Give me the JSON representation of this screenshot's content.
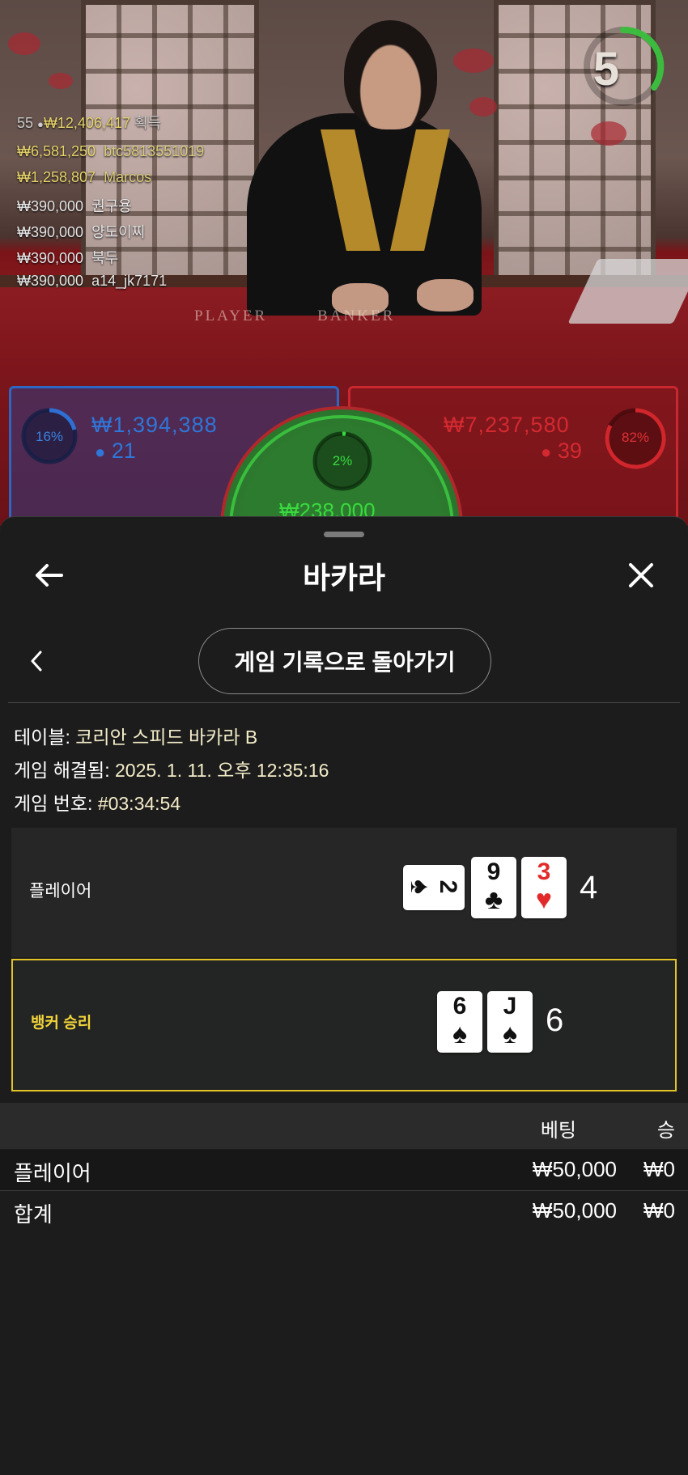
{
  "live": {
    "timer": "5",
    "leaderboard": {
      "summary": {
        "count": "55",
        "total": "₩12,406,417",
        "suffix": "획득"
      },
      "entries": [
        {
          "amount": "₩6,581,250",
          "name": "btc5813551019"
        },
        {
          "amount": "₩1,258,807",
          "name": "Marcos"
        },
        {
          "amount": "₩390,000",
          "name": "권구용"
        },
        {
          "amount": "₩390,000",
          "name": "양도이찌"
        },
        {
          "amount": "₩390,000",
          "name": "북두"
        },
        {
          "amount": "₩390,000",
          "name": "a14_jk7171"
        }
      ]
    },
    "table_text": "PLAYER        BANKER",
    "player": {
      "percent": "16%",
      "percent_value": 16,
      "amount": "₩1,394,388",
      "count": "21"
    },
    "banker": {
      "percent": "82%",
      "percent_value": 82,
      "amount": "₩7,237,580",
      "count": "39"
    },
    "tie": {
      "percent": "2%",
      "percent_value": 2,
      "amount": "₩238,000"
    }
  },
  "sheet": {
    "title": "바카라",
    "back_to_history": "게임 기록으로 돌아가기",
    "info": {
      "table_label": "테이블:",
      "table_value": "코리안 스피드 바카라 B",
      "resolved_label": "게임 해결됨:",
      "resolved_value": "2025. 1. 11. 오후 12:35:16",
      "number_label": "게임 번호:",
      "number_value": "#03:34:54"
    },
    "player_row": {
      "label": "플레이어",
      "cards": [
        {
          "rank": "2",
          "suit": "♠",
          "color": "black",
          "sideways": true
        },
        {
          "rank": "9",
          "suit": "♣",
          "color": "black",
          "sideways": false
        },
        {
          "rank": "3",
          "suit": "♥",
          "color": "red",
          "sideways": false
        }
      ],
      "score": "4"
    },
    "banker_row": {
      "label": "뱅커 승리",
      "cards": [
        {
          "rank": "6",
          "suit": "♠",
          "color": "black",
          "sideways": false
        },
        {
          "rank": "J",
          "suit": "♠",
          "color": "black",
          "sideways": false
        }
      ],
      "score": "6"
    },
    "bet_table": {
      "headers": {
        "bet": "베팅",
        "win": "승"
      },
      "rows": [
        {
          "label": "플레이어",
          "bet": "₩50,000",
          "win": "₩0"
        },
        {
          "label": "합계",
          "bet": "₩50,000",
          "win": "₩0"
        }
      ]
    },
    "colors": {
      "gold_border": "#e2c227",
      "banker_label": "#f2d43a",
      "player_blue": "#2f6fd3",
      "banker_red": "#d0262c",
      "tie_green": "#39d93f"
    },
    "icons": {
      "back": "arrow-left-icon",
      "close": "close-icon",
      "prev": "chevron-left-icon"
    }
  }
}
